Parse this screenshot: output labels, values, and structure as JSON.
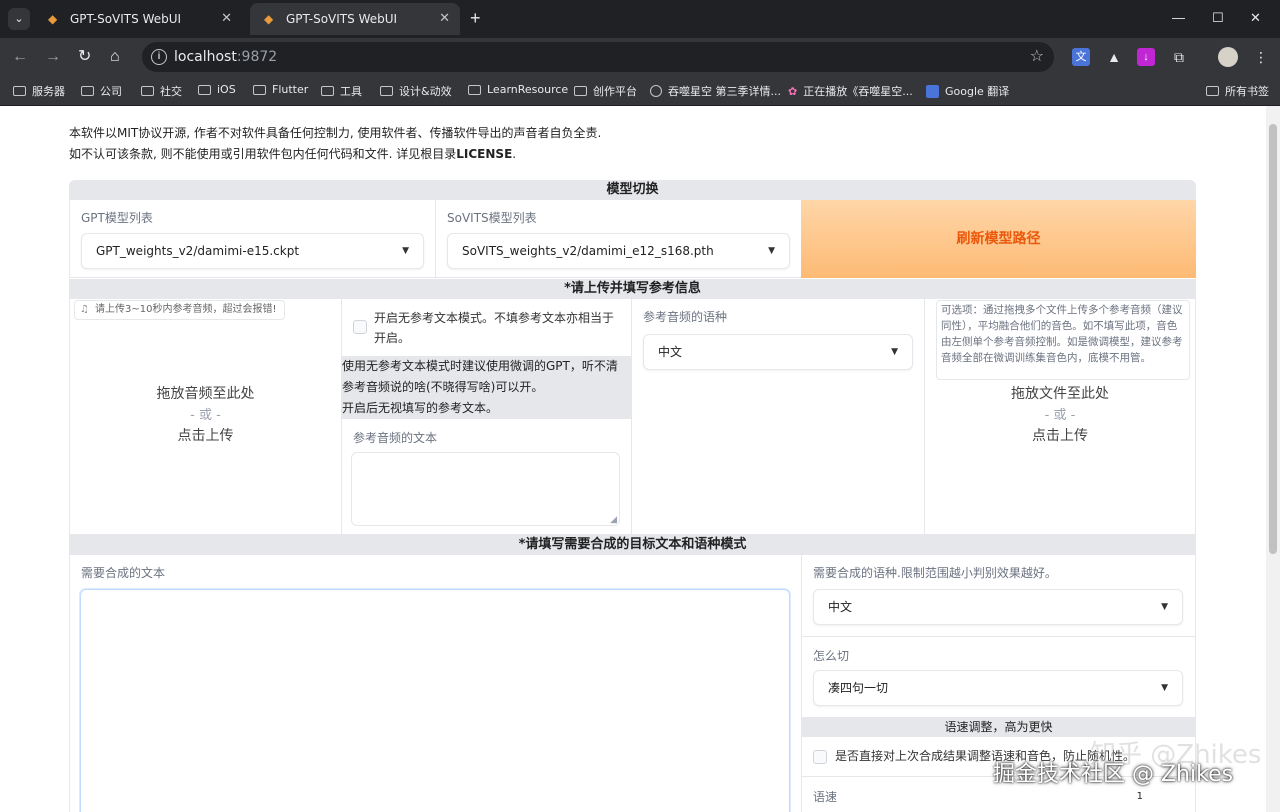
{
  "browser": {
    "tabs": [
      {
        "title": "GPT-SoVITS WebUI"
      },
      {
        "title": "GPT-SoVITS WebUI"
      }
    ],
    "url_host": "localhost",
    "url_port": ":9872",
    "bookmarks": [
      {
        "label": "服务器"
      },
      {
        "label": "公司"
      },
      {
        "label": "社交"
      },
      {
        "label": "iOS"
      },
      {
        "label": "Flutter"
      },
      {
        "label": "工具"
      },
      {
        "label": "设计&动效"
      },
      {
        "label": "LearnResource"
      },
      {
        "label": "创作平台"
      },
      {
        "label": "吞噬星空 第三季详情..."
      },
      {
        "label": "正在播放《吞噬星空..."
      },
      {
        "label": "Google 翻译"
      }
    ],
    "all_bookmarks": "所有书签"
  },
  "notice": {
    "line1": "本软件以MIT协议开源, 作者不对软件具备任何控制力, 使用软件者、传播软件导出的声音者自负全责.",
    "line2_prefix": "如不认可该条款, 则不能使用或引用软件包内任何代码和文件. 详见根目录",
    "line2_bold": "LICENSE",
    "line2_suffix": "."
  },
  "model_switch": {
    "header": "模型切换",
    "gpt_label": "GPT模型列表",
    "gpt_value": "GPT_weights_v2/damimi-e15.ckpt",
    "sovits_label": "SoVITS模型列表",
    "sovits_value": "SoVITS_weights_v2/damimi_e12_s168.pth",
    "refresh_button": "刷新模型路径"
  },
  "reference": {
    "header": "*请上传并填写参考信息",
    "upload_hint": "请上传3~10秒内参考音频，超过会报错!",
    "drop_main": "拖放音频至此处",
    "drop_or": "- 或 -",
    "drop_click": "点击上传",
    "no_ref_checkbox": "开启无参考文本模式。不填参考文本亦相当于开启。",
    "no_ref_note_1": "使用无参考文本模式时建议使用微调的GPT，听不清",
    "no_ref_note_2": "参考音频说的啥(不晓得写啥)可以开。",
    "no_ref_note_3": "开启后无视填写的参考文本。",
    "ref_text_label": "参考音频的文本",
    "ref_lang_label": "参考音频的语种",
    "ref_lang_value": "中文",
    "optional_note": "可选项：通过拖拽多个文件上传多个参考音频（建议同性），平均融合他们的音色。如不填写此项，音色由左侧单个参考音频控制。如是微调模型，建议参考音频全部在微调训练集音色内，底模不用管。",
    "drop_files_main": "拖放文件至此处",
    "drop_files_or": "- 或 -",
    "drop_files_click": "点击上传"
  },
  "synthesis": {
    "header": "*请填写需要合成的目标文本和语种模式",
    "text_label": "需要合成的文本",
    "lang_label": "需要合成的语种.限制范围越小判别效果越好。",
    "lang_value": "中文",
    "split_label": "怎么切",
    "split_value": "凑四句一切",
    "speed_header": "语速调整，高为更快",
    "speed_checkbox": "是否直接对上次合成结果调整语速和音色，防止随机性。",
    "speed_label": "语速",
    "speed_value": "1"
  },
  "watermark": {
    "text": "掘金技术社区 @ Zhikes",
    "ghost": "知乎 @Zhikes"
  },
  "colors": {
    "accent_orange": "#ea580c",
    "header_gray": "#e5e7eb",
    "chrome_dark": "#202124"
  }
}
